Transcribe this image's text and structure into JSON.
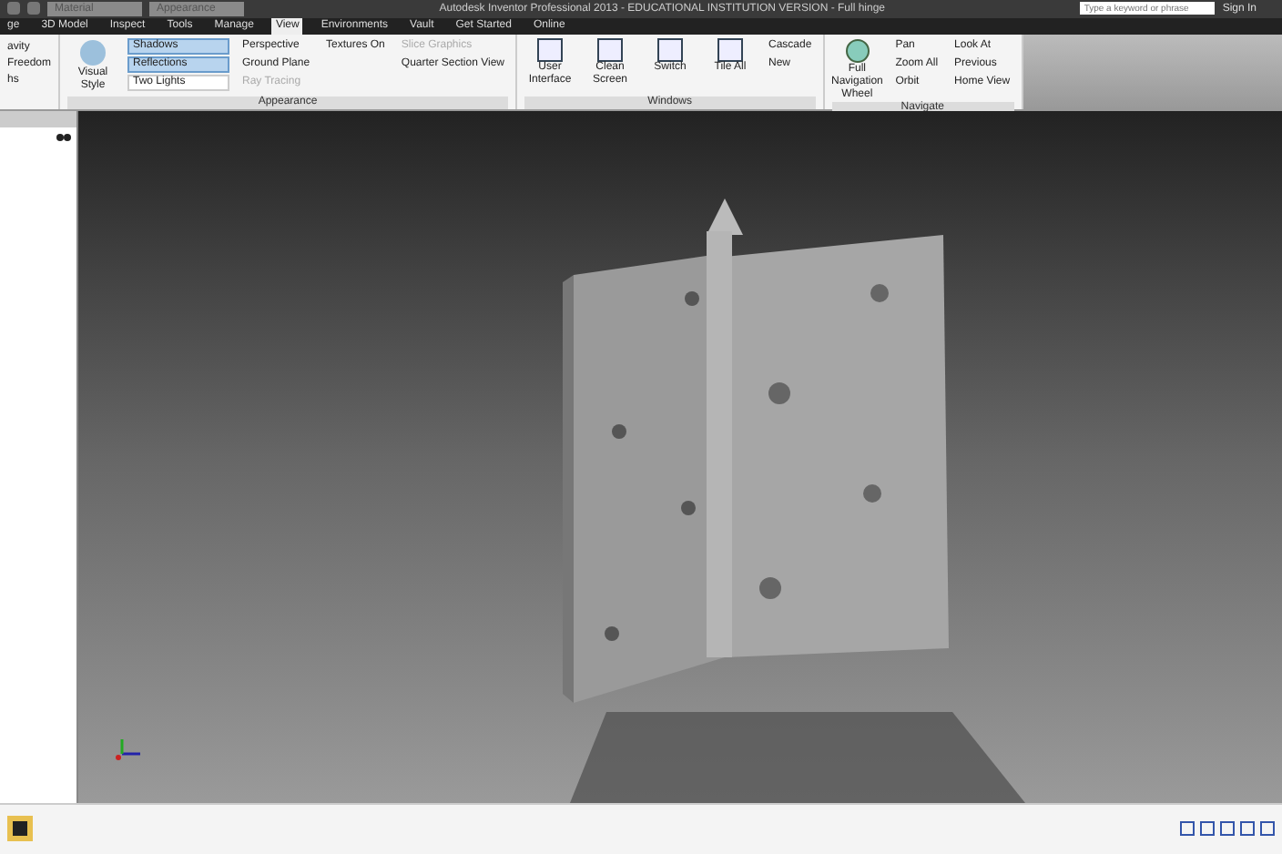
{
  "title_bar": {
    "material": "Material",
    "appearance": "Appearance",
    "title": "Autodesk Inventor Professional 2013 - EDUCATIONAL INSTITUTION VERSION - Full hinge",
    "search": {
      "placeholder": "Type a keyword or phrase"
    },
    "sign_in": "Sign In"
  },
  "tabs": [
    {
      "label": "ge",
      "selected": false
    },
    {
      "label": "3D Model",
      "selected": false
    },
    {
      "label": "Inspect",
      "selected": false
    },
    {
      "label": "Tools",
      "selected": false
    },
    {
      "label": "Manage",
      "selected": false
    },
    {
      "label": "View",
      "selected": true
    },
    {
      "label": "Environments",
      "selected": false
    },
    {
      "label": "Vault",
      "selected": false
    },
    {
      "label": "Get Started",
      "selected": false
    },
    {
      "label": "Online",
      "selected": false
    }
  ],
  "visibility_panel": {
    "items": [
      "avity",
      "Freedom",
      "hs"
    ]
  },
  "appearance_panel": {
    "label": "Appearance",
    "visual_style": "Visual Style",
    "toggles": [
      {
        "label": "Shadows",
        "on": true
      },
      {
        "label": "Reflections",
        "on": true
      }
    ],
    "lighting": "Two Lights",
    "column_2": [
      {
        "label": "Perspective",
        "disabled": false
      },
      {
        "label": "Ground Plane",
        "disabled": false
      },
      {
        "label": "Ray Tracing",
        "disabled": true
      }
    ],
    "column_3": [
      {
        "label": "Textures On",
        "disabled": false
      }
    ],
    "column_4": [
      {
        "label": "Slice Graphics",
        "disabled": true
      },
      {
        "label": "Quarter Section View",
        "disabled": false
      }
    ]
  },
  "windows_panel": {
    "label": "Windows",
    "large": [
      "User Interface",
      "Clean Screen",
      "Switch",
      "Tile All"
    ],
    "small": [
      "Cascade",
      "New"
    ]
  },
  "navigate_panel": {
    "label": "Navigate",
    "wheel": "Full Navigation Wheel",
    "column_1": [
      "Pan",
      "Zoom All",
      "Orbit"
    ],
    "column_2": [
      "Look At",
      "Previous",
      "Home View"
    ]
  }
}
